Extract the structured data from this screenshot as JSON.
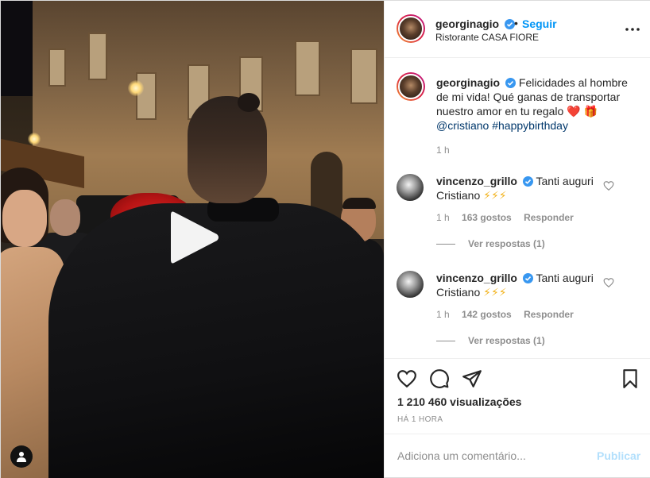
{
  "post": {
    "author": "georginagio",
    "follow_separator": "•",
    "follow_label": "Seguir",
    "location": "Ristorante CASA FIORE"
  },
  "caption": {
    "username": "georginagio",
    "text": "Felicidades al hombre de mi vida! Qué ganas de transportar nuestro amor en tu regalo",
    "emoji": "❤️ 🎁",
    "mention": "@cristiano",
    "hashtag": "#happybirthday",
    "time": "1 h"
  },
  "comments": [
    {
      "username": "vincenzo_grillo",
      "text": "Tanti auguri Cristiano",
      "emoji": "⚡⚡⚡",
      "time": "1 h",
      "likes": "163 gostos",
      "reply_label": "Responder",
      "view_replies": "Ver respostas (1)"
    },
    {
      "username": "vincenzo_grillo",
      "text": "Tanti auguri Cristiano",
      "emoji": "⚡⚡⚡",
      "time": "1 h",
      "likes": "142 gostos",
      "reply_label": "Responder",
      "view_replies": "Ver respostas (1)"
    }
  ],
  "stats": {
    "views": "1 210 460 visualizações",
    "posted_ago": "HÁ 1 HORA"
  },
  "add_comment": {
    "placeholder": "Adiciona um comentário...",
    "publish_label": "Publicar"
  },
  "icons": {
    "more": "more-horizontal-icon",
    "like": "heart-icon",
    "comment": "comment-icon",
    "share": "paper-plane-icon",
    "save": "bookmark-icon",
    "play": "play-icon",
    "tag": "user-tag-icon",
    "verified": "verified-badge-icon"
  },
  "colors": {
    "link_blue": "#0095f6",
    "publish_disabled": "#b2dffc",
    "secondary_text": "#8e8e8e",
    "verified": "#3897f0"
  }
}
